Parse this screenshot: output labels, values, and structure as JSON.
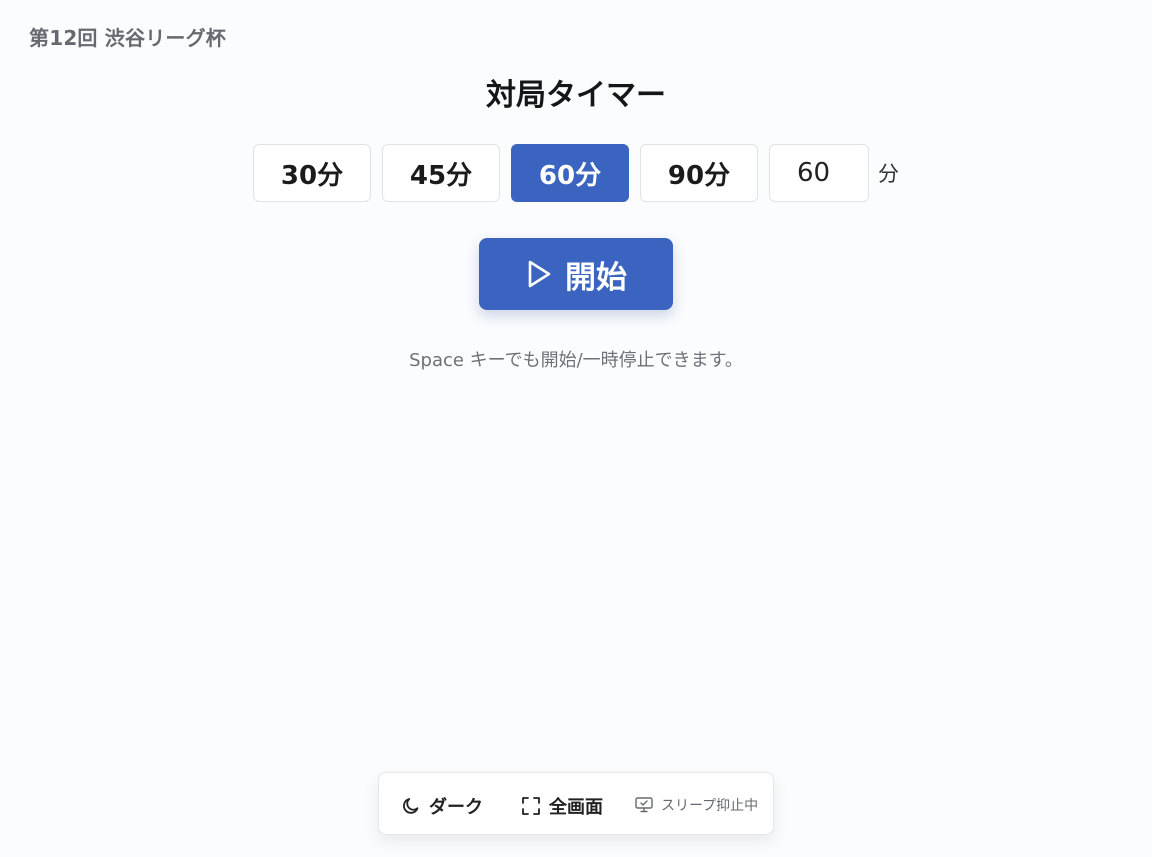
{
  "header": {
    "event_title": "第12回 渋谷リーグ杯"
  },
  "timer": {
    "title": "対局タイマー",
    "presets": [
      {
        "label": "30分",
        "active": false
      },
      {
        "label": "45分",
        "active": false
      },
      {
        "label": "60分",
        "active": true
      },
      {
        "label": "90分",
        "active": false
      }
    ],
    "custom_minutes_value": "60",
    "custom_unit": "分",
    "start_label": "開始",
    "hint": "Space キーでも開始/一時停止できます。"
  },
  "toolbar": {
    "dark_label": "ダーク",
    "fullscreen_label": "全画面",
    "sleep_label": "スリープ抑止中"
  },
  "icons": {
    "start": "play-icon",
    "dark": "moon-icon",
    "fullscreen": "fullscreen-icon",
    "sleep": "monitor-check-icon"
  },
  "colors": {
    "accent": "#3a64c0",
    "background": "#fbfcfe",
    "muted_text": "#6d7178"
  }
}
